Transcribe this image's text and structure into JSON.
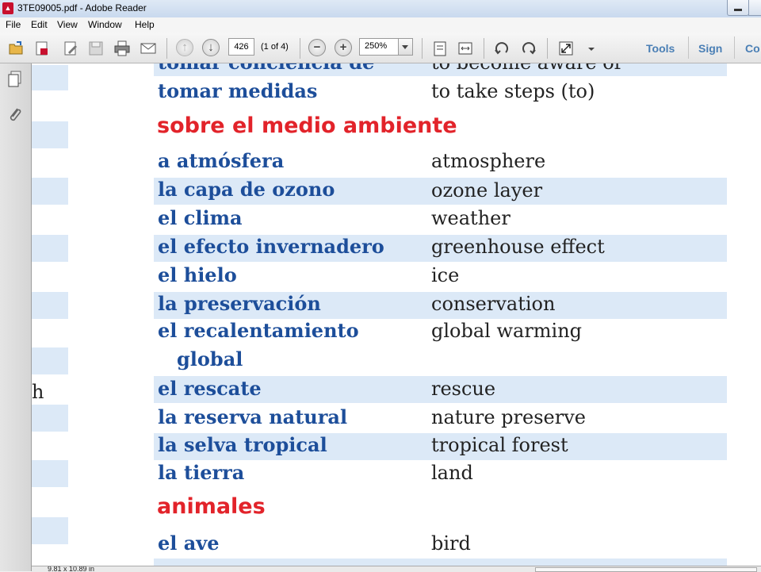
{
  "window": {
    "title": "3TE09005.pdf - Adobe Reader"
  },
  "menu": [
    "File",
    "Edit",
    "View",
    "Window",
    "Help"
  ],
  "toolbar": {
    "page_number": "426",
    "page_count": "(1 of 4)",
    "zoom": "250%",
    "tools_label": "Tools",
    "sign_label": "Sign",
    "comment_label": "Co"
  },
  "status": {
    "page_size": "9.81 x 10.89 in"
  },
  "stray_letter": "h",
  "document": {
    "top_rows": [
      {
        "es": "tomar conciencia de",
        "en": "to become aware of"
      },
      {
        "es": "tomar medidas",
        "en": "to take steps (to)"
      }
    ],
    "section1": {
      "heading": "sobre el medio ambiente",
      "rows": [
        {
          "es": "a atmósfera",
          "en": "atmosphere"
        },
        {
          "es": "la capa de ozono",
          "en": "ozone layer"
        },
        {
          "es": "el clima",
          "en": "weather"
        },
        {
          "es": "el efecto invernadero",
          "en": "greenhouse effect"
        },
        {
          "es": "el hielo",
          "en": "ice"
        },
        {
          "es": "la preservación",
          "en": "conservation"
        },
        {
          "es": "el recalentamiento",
          "es2": "global",
          "en": "global warming"
        },
        {
          "es": "el rescate",
          "en": "rescue"
        },
        {
          "es": "la reserva natural",
          "en": "nature preserve"
        },
        {
          "es": "la selva tropical",
          "en": "tropical forest"
        },
        {
          "es": "la tierra",
          "en": "land"
        }
      ]
    },
    "section2": {
      "heading": "animales",
      "rows": [
        {
          "es": "el ave",
          "en": "bird"
        }
      ]
    }
  }
}
